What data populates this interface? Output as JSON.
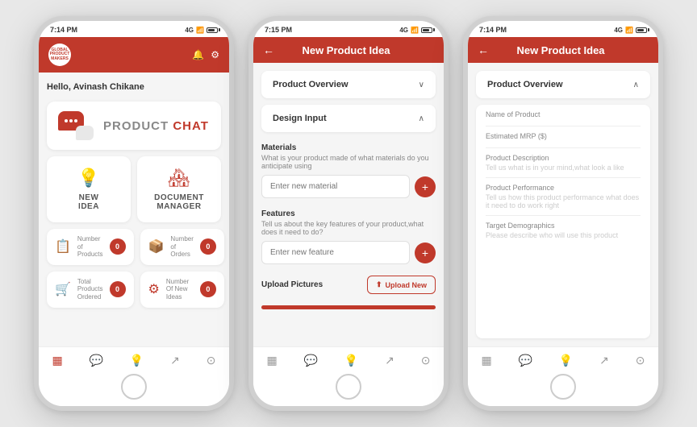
{
  "phones": [
    {
      "id": "phone1",
      "statusBar": {
        "time": "7:14 PM",
        "signal": "4G",
        "battery": 80
      },
      "header": {
        "type": "logo",
        "logoLines": [
          "GLOBAL",
          "PRODUCT",
          "MAKERS"
        ],
        "notificationIcon": "🔔",
        "settingsIcon": "⚙"
      },
      "greeting": {
        "prefix": "Hello, ",
        "name": "Avinash Chikane"
      },
      "chatBanner": {
        "label1": "PRODUCT",
        "label2": "CHAT"
      },
      "actions": [
        {
          "icon": "💡",
          "line1": "NEW",
          "line2": "IDEA"
        },
        {
          "icon": "🏠",
          "line1": "DOCUMENT",
          "line2": "MANAGER"
        }
      ],
      "stats": [
        {
          "icon": "📋",
          "label": "Number\nof Products",
          "count": "0"
        },
        {
          "icon": "📦",
          "label": "Number\nof Orders",
          "count": "0"
        },
        {
          "icon": "🛒",
          "label": "Total Products\nOrdered",
          "count": "0"
        },
        {
          "icon": "⚙",
          "label": "Number\nOf New Ideas",
          "count": "0"
        }
      ],
      "navItems": [
        "▦",
        "💬",
        "💡",
        "↗",
        "⊙"
      ]
    },
    {
      "id": "phone2",
      "statusBar": {
        "time": "7:15 PM",
        "signal": "4G",
        "battery": 80
      },
      "header": {
        "type": "title",
        "title": "New Product Idea"
      },
      "accordions": [
        {
          "label": "Product Overview",
          "open": false
        },
        {
          "label": "Design Input",
          "open": true
        }
      ],
      "sections": [
        {
          "label": "Materials",
          "hint": "What is your product made of what materials do you anticipate using",
          "placeholder": "Enter new material"
        },
        {
          "label": "Features",
          "hint": "Tell us about the key features of your product,what does it need to do?",
          "placeholder": "Enter new feature"
        }
      ],
      "uploadLabel": "Upload Pictures",
      "uploadBtn": "Upload New",
      "navItems": [
        "▦",
        "💬",
        "💡",
        "↗",
        "⊙"
      ]
    },
    {
      "id": "phone3",
      "statusBar": {
        "time": "7:14 PM",
        "signal": "4G",
        "battery": 80
      },
      "header": {
        "type": "title",
        "title": "New Product Idea"
      },
      "accordions": [
        {
          "label": "Product Overview",
          "open": true
        }
      ],
      "fields": [
        {
          "label": "Name of Product",
          "placeholder": ""
        },
        {
          "label": "Estimated MRP ($)",
          "placeholder": ""
        },
        {
          "label": "Product Description",
          "placeholder": "Tell us what is in your mind,what look a like"
        },
        {
          "label": "Product Performance",
          "placeholder": "Tell us how this product performance what does it need to do work right"
        },
        {
          "label": "Target Demographics",
          "placeholder": "Please describe who will use this product"
        }
      ],
      "navItems": [
        "▦",
        "💬",
        "💡",
        "↗",
        "⊙"
      ]
    }
  ]
}
